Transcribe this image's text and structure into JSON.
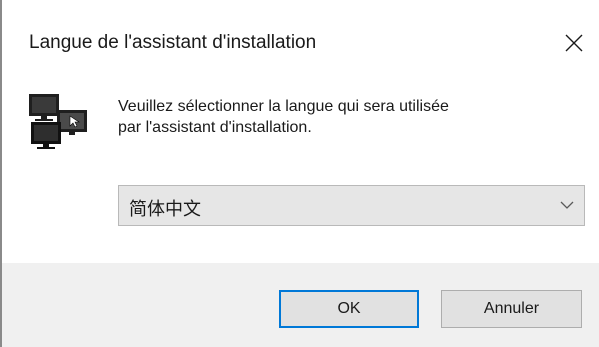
{
  "dialog": {
    "title": "Langue de l'assistant d'installation",
    "message_line1": "Veuillez sélectionner la langue qui sera utilisée",
    "message_line2": "par l'assistant d'installation.",
    "icon": "monitors-icon",
    "close_icon": "close-icon"
  },
  "language_select": {
    "selected": "简体中文",
    "dropdown_icon": "chevron-down-icon"
  },
  "buttons": {
    "ok_label": "OK",
    "cancel_label": "Annuler"
  },
  "colors": {
    "accent": "#0078d7",
    "footer_bg": "#f0f0f0",
    "select_bg": "#e6e6e6",
    "button_bg": "#e1e1e1"
  }
}
